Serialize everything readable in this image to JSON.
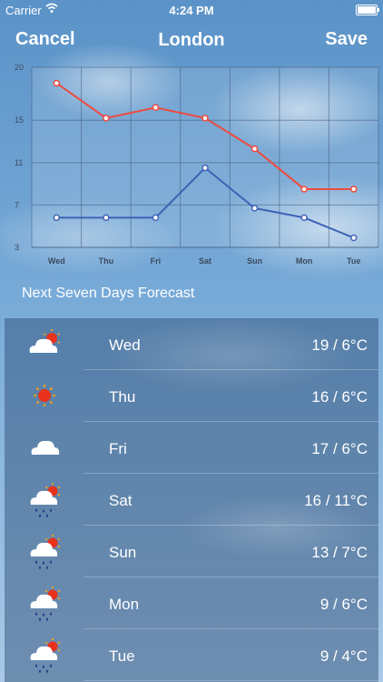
{
  "status_bar": {
    "carrier": "Carrier",
    "time": "4:24 PM"
  },
  "nav": {
    "cancel": "Cancel",
    "title": "London",
    "save": "Save"
  },
  "subtitle": "Next Seven Days Forecast",
  "colors": {
    "high_line": "#ee4b3f",
    "low_line": "#3f63b6",
    "sun": "#e8321c"
  },
  "chart_data": {
    "type": "line",
    "categories": [
      "Wed",
      "Thu",
      "Fri",
      "Sat",
      "Sun",
      "Mon",
      "Tue"
    ],
    "series": [
      {
        "values": [
          18.5,
          15.2,
          16.2,
          15.2,
          12.3,
          8.5,
          8.5
        ],
        "color": "#ee4b3f"
      },
      {
        "values": [
          5.8,
          5.8,
          5.8,
          10.5,
          6.7,
          5.8,
          3.9
        ],
        "color": "#3f63b6"
      }
    ],
    "y_ticks": [
      20,
      15,
      11,
      7,
      3
    ],
    "ylim": [
      3,
      20
    ],
    "grid": true
  },
  "forecast": [
    {
      "day": "Wed",
      "temp": "19 / 6°C",
      "icon": "partly-cloudy-icon"
    },
    {
      "day": "Thu",
      "temp": "16 / 6°C",
      "icon": "sun-icon"
    },
    {
      "day": "Fri",
      "temp": "17 / 6°C",
      "icon": "cloud-icon"
    },
    {
      "day": "Sat",
      "temp": "16 / 11°C",
      "icon": "rain-sun-icon"
    },
    {
      "day": "Sun",
      "temp": "13 / 7°C",
      "icon": "rain-sun-icon"
    },
    {
      "day": "Mon",
      "temp": "9 / 6°C",
      "icon": "rain-sun-icon"
    },
    {
      "day": "Tue",
      "temp": "9 / 4°C",
      "icon": "rain-sun-icon"
    }
  ]
}
